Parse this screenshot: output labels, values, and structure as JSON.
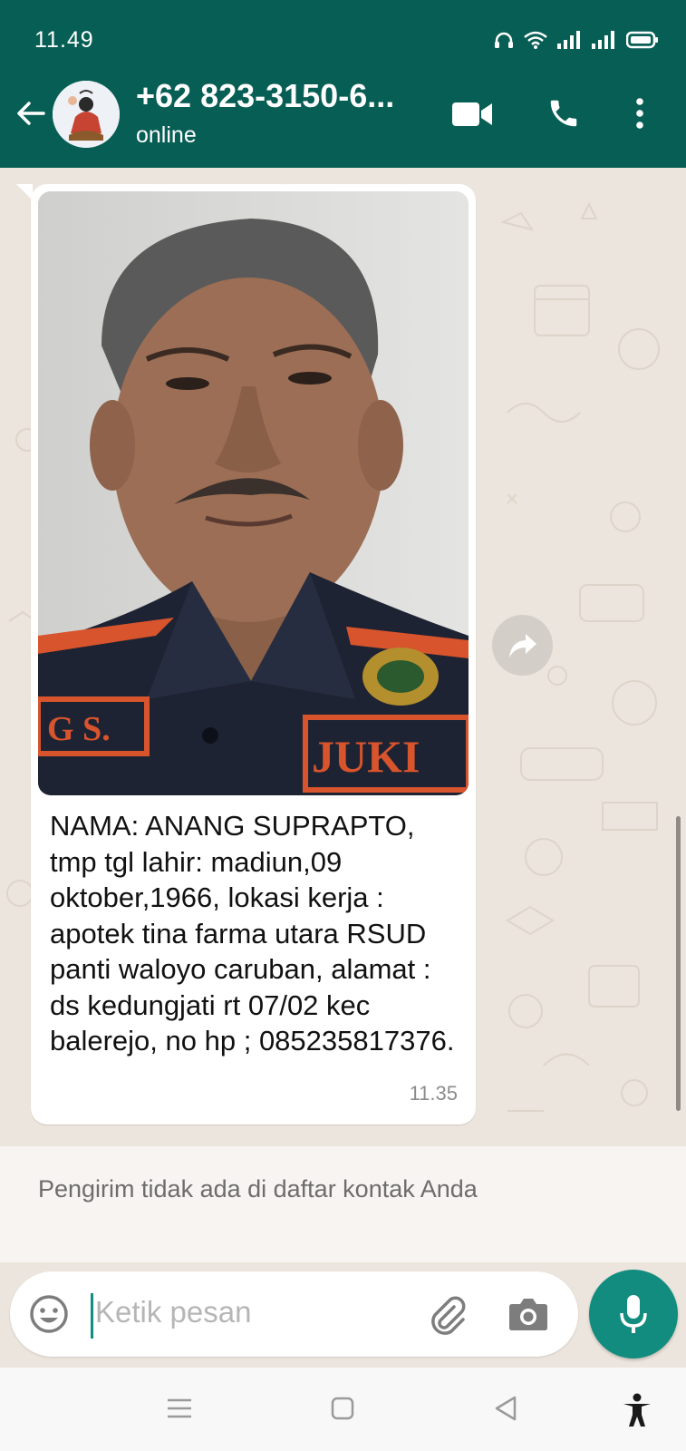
{
  "status_bar": {
    "time": "11.49",
    "icons": [
      "headphones-icon",
      "wifi-icon",
      "signal-icon",
      "signal-icon",
      "battery-icon"
    ]
  },
  "app_bar": {
    "contact_name": "+62 823-3150-6...",
    "contact_status": "online",
    "actions": [
      "video-call-icon",
      "voice-call-icon",
      "more-options-icon"
    ],
    "color": "#075e54"
  },
  "message": {
    "text": "NAMA: ANANG SUPRAPTO, tmp tgl lahir: madiun,09 oktober,1966, lokasi kerja : apotek tina farma utara RSUD panti waloyo caruban, alamat : ds kedungjati rt 07/02 kec balerejo, no hp ; 085235817376.",
    "time": "11.35",
    "photo_uniform_texts": [
      "G S.",
      "JUKI"
    ]
  },
  "notice": {
    "text": "Pengirim tidak ada di daftar kontak Anda"
  },
  "composer": {
    "placeholder": "Ketik pesan",
    "accent": "#128c7e"
  },
  "nav_bar": {
    "items": [
      "menu-icon",
      "home-icon",
      "back-icon",
      "accessibility-icon"
    ]
  }
}
